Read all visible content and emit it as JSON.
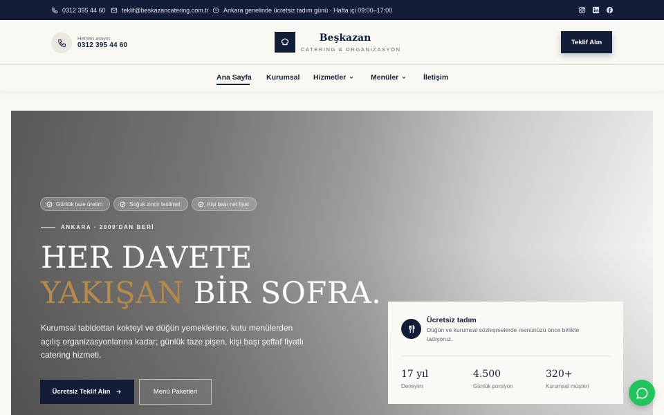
{
  "topbar": {
    "phone": "0312 395 44 60",
    "email": "teklif@beskazancatering.com.tr",
    "hours": "Ankara genelinde ücretsiz tadım günü · Hafta içi 09:00–17:00",
    "social": [
      "instagram-icon",
      "linkedin-icon",
      "facebook-icon"
    ]
  },
  "header": {
    "call_label": "Hemen arayın",
    "call_number": "0312 395 44 60",
    "logo_name": "Beşkazan",
    "logo_sub": "CATERING & ORGANİZASYON",
    "cta": "Teklif Alın"
  },
  "nav": {
    "items": [
      {
        "label": "Ana Sayfa",
        "active": true
      },
      {
        "label": "Kurumsal"
      },
      {
        "label": "Hizmetler",
        "dropdown": true
      },
      {
        "label": "Menüler",
        "dropdown": true
      },
      {
        "label": "İletişim"
      }
    ]
  },
  "hero": {
    "badges": [
      "Günlük taze üretim",
      "Soğuk zincir teslimat",
      "Kişi başı net fiyat"
    ],
    "eyebrow": "ANKARA · 2009'DAN BERİ",
    "title_line1": "HER DAVETE",
    "title_gold": "YAKIŞAN",
    "title_rest": " BİR SOFRA.",
    "description": "Kurumsal tabldottan kokteyl ve düğün yemeklerine, kutu menülerden açılış organizasyonlarına kadar; günlük taze pişen, kişi başı şeffaf fiyatlı catering hizmeti.",
    "primary_button": "Ücretsiz Teklif Alın",
    "secondary_button": "Menü Paketleri"
  },
  "card": {
    "title": "Ücretsiz tadım",
    "text": "Düğün ve kurumsal sözleşmelerde menünüzü önce birlikte tadıyoruz.",
    "stats": [
      {
        "value": "17 yıl",
        "label": "Deneyim"
      },
      {
        "value": "4.500",
        "label": "Günlük porsiyon"
      },
      {
        "value": "320+",
        "label": "Kurumsal müşteri"
      }
    ]
  },
  "colors": {
    "navy": "#141d38",
    "gold": "#b48a4d",
    "cream": "#faf8f3",
    "whatsapp": "#25c35f"
  }
}
